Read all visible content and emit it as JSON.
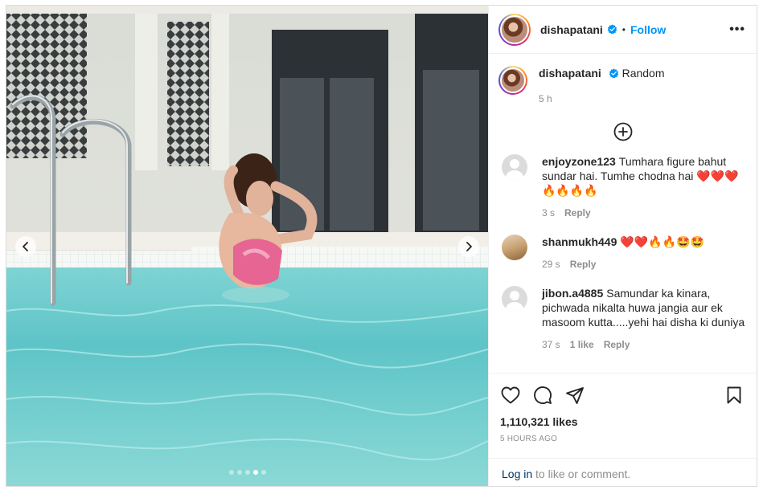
{
  "post": {
    "username": "dishapatani",
    "separator": "•",
    "follow_label": "Follow",
    "more_label": "•••",
    "caption_text": "Random",
    "caption_time": "5 h"
  },
  "comments": [
    {
      "username": "enjoyzone123",
      "text": "Tumhara figure bahut sundar hai. Tumhe chodna hai ❤️❤️❤️ 🔥🔥🔥🔥",
      "time": "3 s",
      "reply_label": "Reply"
    },
    {
      "username": "shanmukh449",
      "text": "❤️❤️🔥🔥🤩🤩",
      "time": "29 s",
      "reply_label": "Reply"
    },
    {
      "username": "jibon.a4885",
      "text": "Samundar ka kinara, pichwada nikalta huwa jangia aur ek masoom kutta.....yehi hai disha ki duniya",
      "time": "37 s",
      "likes": "1 like",
      "reply_label": "Reply"
    }
  ],
  "stats": {
    "likes": "1,110,321 likes",
    "posted": "5 HOURS AGO"
  },
  "login": {
    "link": "Log in",
    "suffix": " to like or comment."
  },
  "carousel": {
    "count": 5,
    "active_index": 3
  },
  "icons": {
    "verified": "verified-badge-icon",
    "like": "heart-icon",
    "comment": "comment-icon",
    "share": "paper-plane-icon",
    "save": "bookmark-icon",
    "load_more": "plus-circle-icon",
    "prev": "chevron-left-icon",
    "next": "chevron-right-icon"
  },
  "colors": {
    "accent": "#0095f6",
    "link": "#00376b",
    "muted": "#8e8e8e",
    "verified": "#0095f6"
  }
}
